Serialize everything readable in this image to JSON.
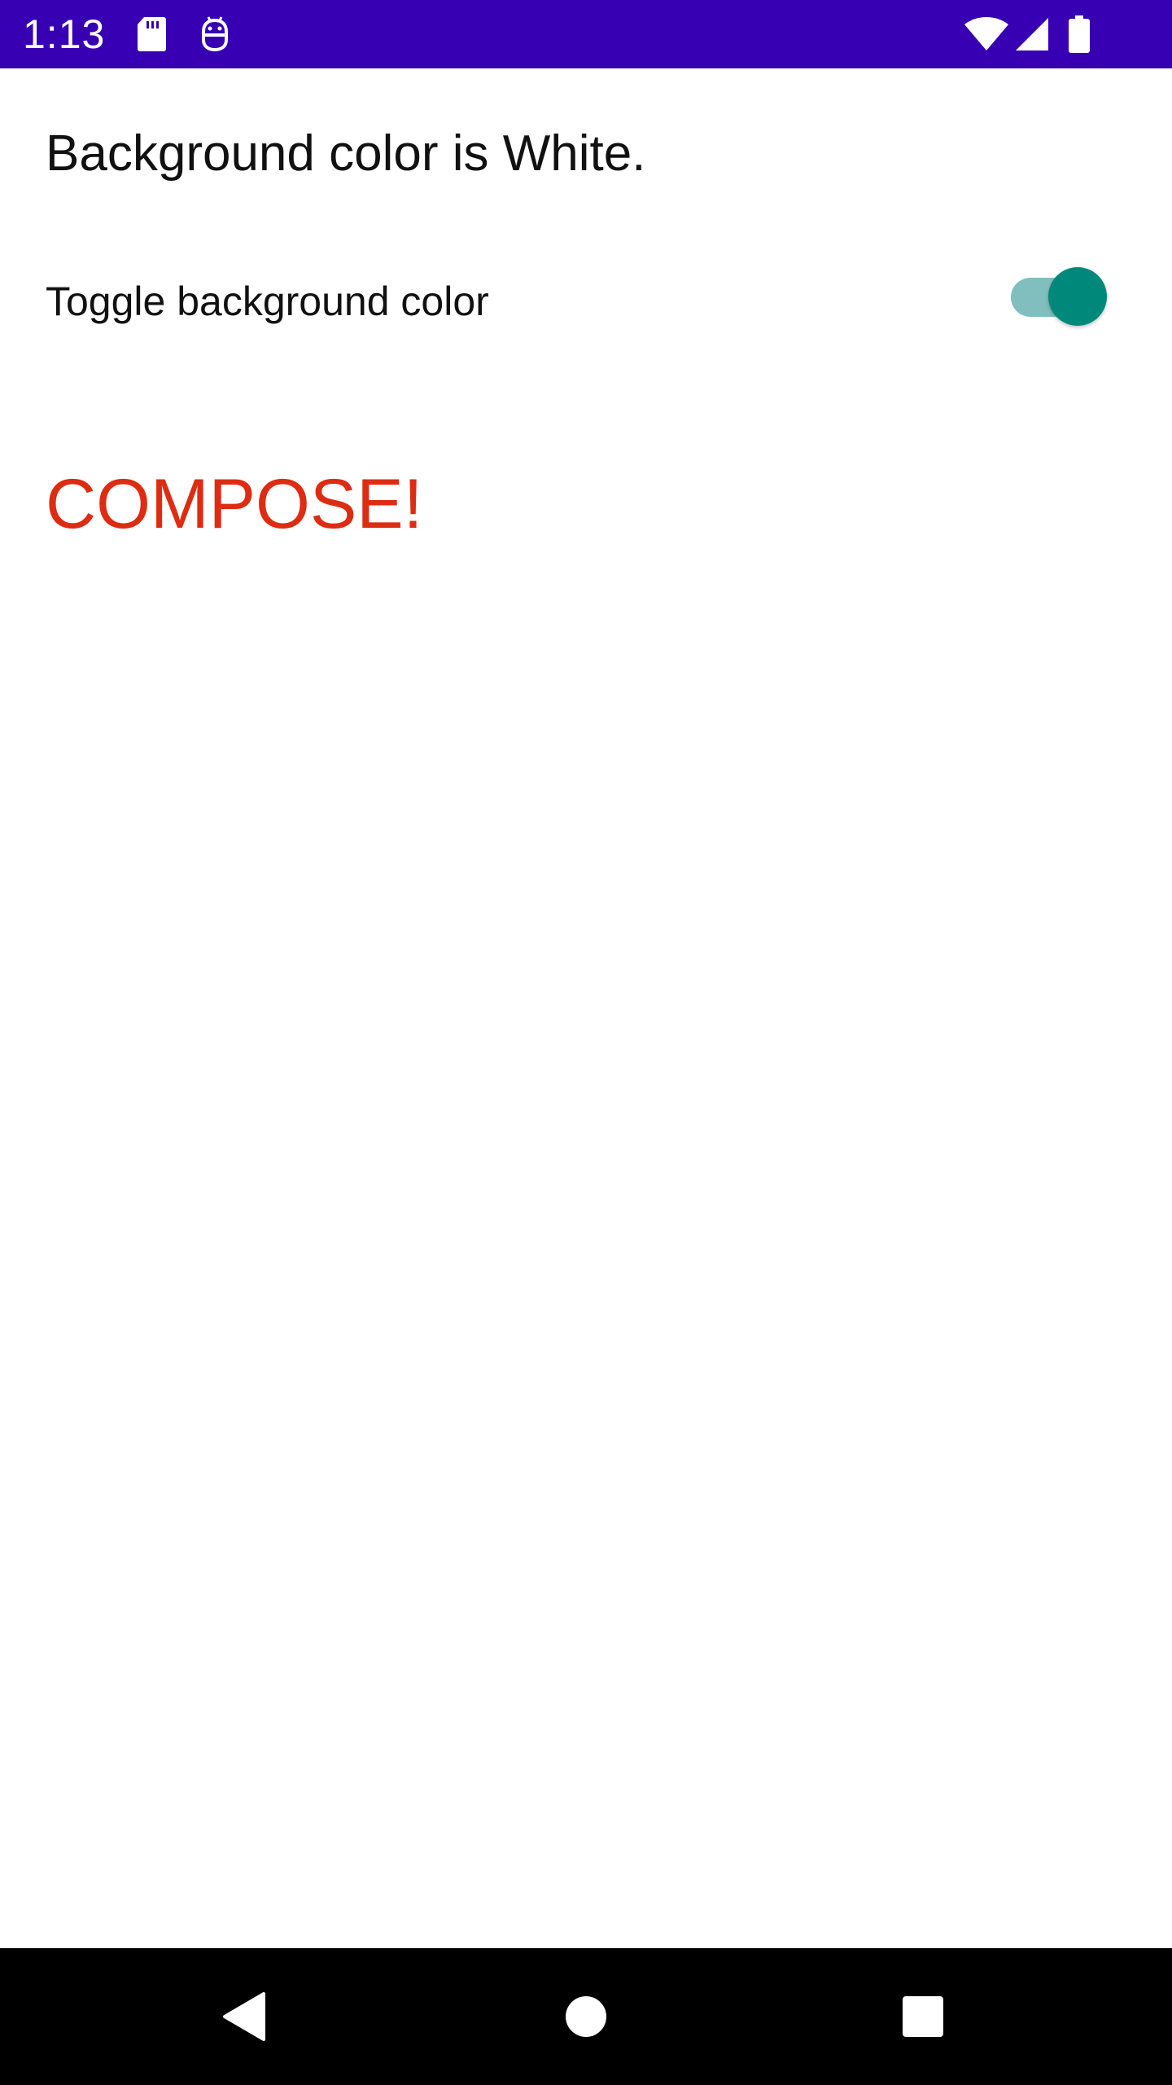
{
  "status_bar": {
    "time": "1:13",
    "icons": [
      "sd-card-icon",
      "debug-icon",
      "wifi-icon",
      "cell-signal-icon",
      "battery-icon"
    ],
    "background_color": "#3700b3"
  },
  "main": {
    "background_status": "Background color is White.",
    "toggle": {
      "label": "Toggle background color",
      "checked": true,
      "thumb_color": "#00897b",
      "track_color": "#80bfbd"
    },
    "compose_text": "COMPOSE!",
    "compose_color": "#dd2c12"
  },
  "navigation_bar": {
    "buttons": [
      "back-icon",
      "home-icon",
      "recents-icon"
    ]
  }
}
